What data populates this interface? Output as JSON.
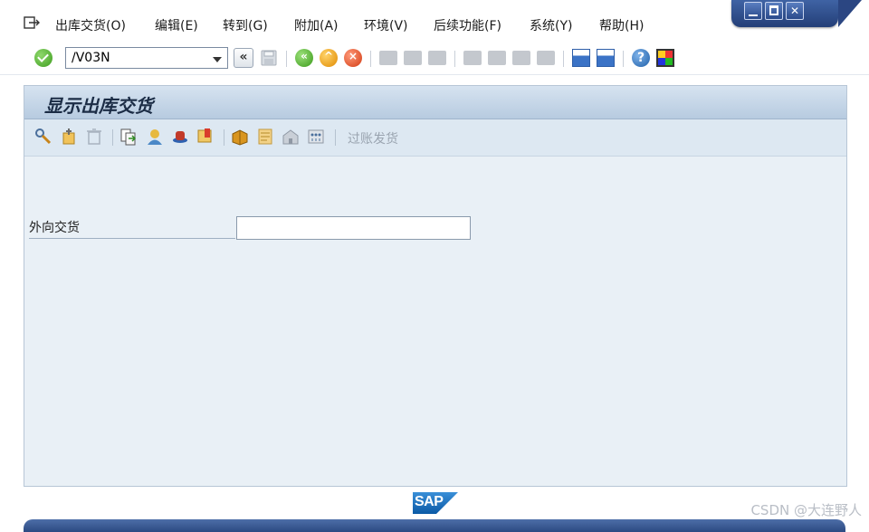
{
  "window": {
    "minimize_icon": "minimize-icon",
    "maximize_icon": "maximize-icon",
    "close_icon": "close-icon",
    "close_glyph": "✕"
  },
  "menu": {
    "items": [
      {
        "label": "出库交货(O)"
      },
      {
        "label": "编辑(E)"
      },
      {
        "label": "转到(G)"
      },
      {
        "label": "附加(A)"
      },
      {
        "label": "环境(V)"
      },
      {
        "label": "后续功能(F)"
      },
      {
        "label": "系统(Y)"
      },
      {
        "label": "帮助(H)"
      }
    ]
  },
  "toolbar": {
    "command_value": "/V03N",
    "back2_glyph": "«",
    "help_glyph": "?"
  },
  "panel": {
    "title": "显示出库交货",
    "post_goods_label": "过账发货",
    "field_label": "外向交货",
    "field_value": ""
  },
  "footer": {
    "logo_text": "SAP",
    "watermark": "CSDN @大连野人"
  },
  "colors": {
    "accent": "#2c4a82",
    "panel_bg": "#e9f0f6",
    "title_bar": "#c6d7e8"
  }
}
